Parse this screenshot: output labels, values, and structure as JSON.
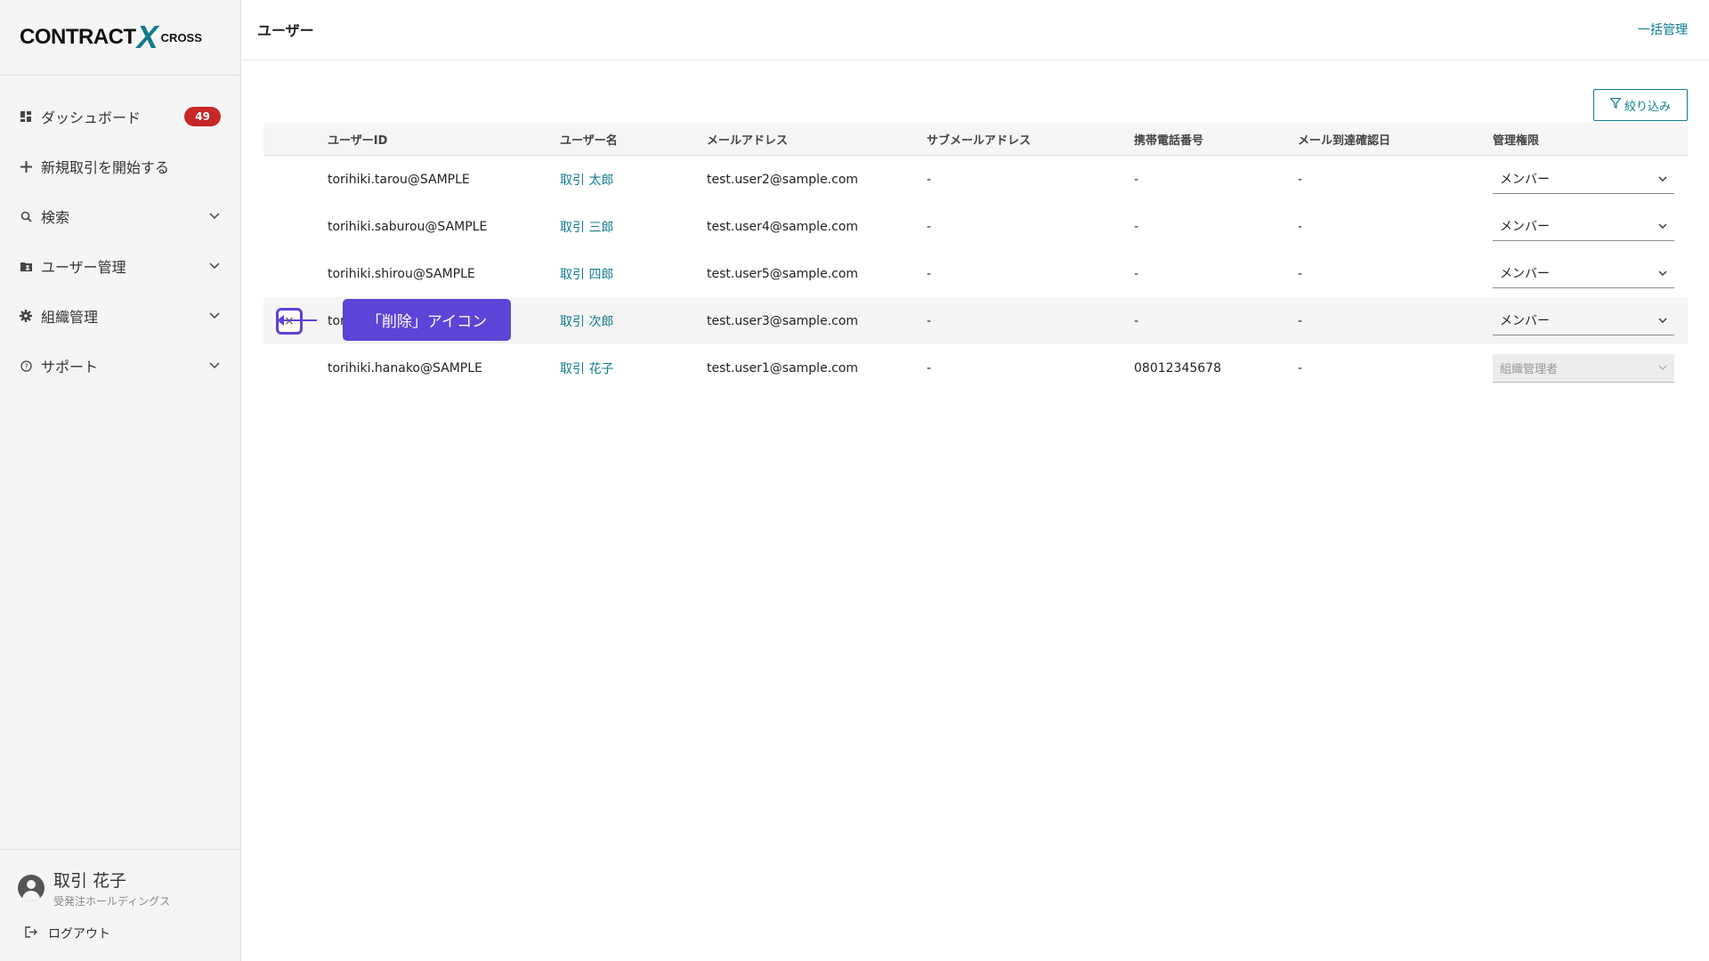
{
  "app": {
    "logo_main": "CONTRACT",
    "logo_x": "X",
    "logo_sub": "CROSS"
  },
  "sidebar": {
    "items": [
      {
        "label": "ダッシュボード",
        "badge": "49",
        "icon": "dashboard-icon"
      },
      {
        "label": "新規取引を開始する",
        "icon": "plus-icon"
      },
      {
        "label": "検索",
        "icon": "search-icon"
      },
      {
        "label": "ユーザー管理",
        "icon": "folder-user-icon"
      },
      {
        "label": "組織管理",
        "icon": "gear-icon"
      },
      {
        "label": "サポート",
        "icon": "help-icon"
      }
    ],
    "user": {
      "name": "取引 花子",
      "org": "受発注ホールディングス"
    },
    "logout": "ログアウト"
  },
  "header": {
    "title": "ユーザー",
    "bulk_link": "一括管理"
  },
  "filter": {
    "label": "絞り込み"
  },
  "table": {
    "headers": [
      "ユーザーID",
      "ユーザー名",
      "メールアドレス",
      "サブメールアドレス",
      "携帯電話番号",
      "メール到達確認日",
      "管理権限"
    ],
    "rows": [
      {
        "id": "torihiki.tarou@SAMPLE",
        "name": "取引 太郎",
        "email": "test.user2@sample.com",
        "sub": "-",
        "phone": "-",
        "confirm": "-",
        "role": "メンバー"
      },
      {
        "id": "torihiki.saburou@SAMPLE",
        "name": "取引 三郎",
        "email": "test.user4@sample.com",
        "sub": "-",
        "phone": "-",
        "confirm": "-",
        "role": "メンバー"
      },
      {
        "id": "torihiki.shirou@SAMPLE",
        "name": "取引 四郎",
        "email": "test.user5@sample.com",
        "sub": "-",
        "phone": "-",
        "confirm": "-",
        "role": "メンバー"
      },
      {
        "id": "tor",
        "name": "取引 次郎",
        "email": "test.user3@sample.com",
        "sub": "-",
        "phone": "-",
        "confirm": "-",
        "role": "メンバー"
      },
      {
        "id": "torihiki.hanako@SAMPLE",
        "name": "取引 花子",
        "email": "test.user1@sample.com",
        "sub": "-",
        "phone": "08012345678",
        "confirm": "-",
        "role": "組織管理者"
      }
    ]
  },
  "annotation": {
    "callout_text": "「削除」アイコン",
    "delete_glyph": "×"
  },
  "colors": {
    "accent": "#0f7c8c",
    "badge": "#c62828",
    "callout": "#5b45d6"
  }
}
